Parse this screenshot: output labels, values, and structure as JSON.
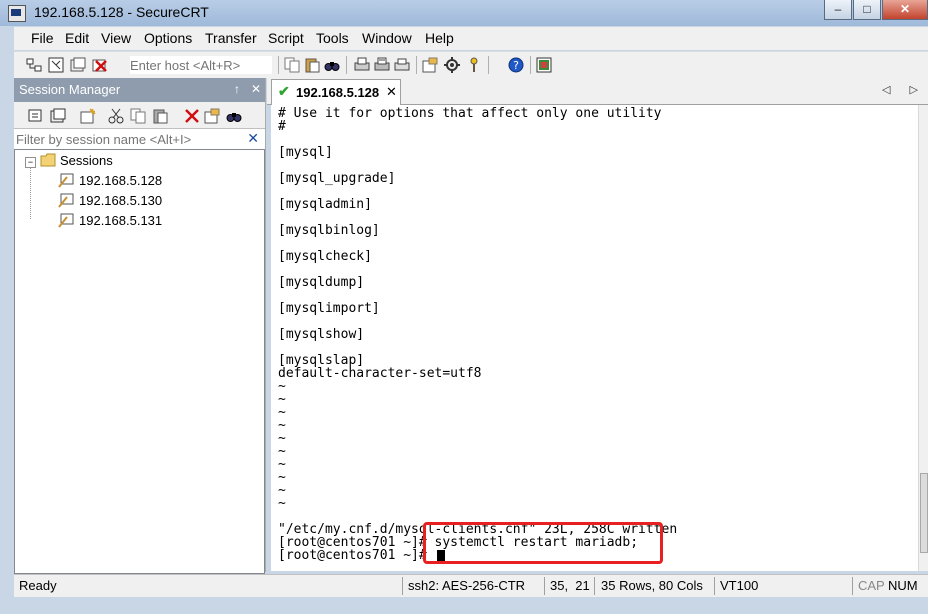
{
  "window": {
    "title": "192.168.5.128 - SecureCRT",
    "buttons": [
      "–",
      "□",
      "✕"
    ]
  },
  "menu": [
    "File",
    "Edit",
    "View",
    "Options",
    "Transfer",
    "Script",
    "Tools",
    "Window",
    "Help"
  ],
  "toolbar": {
    "host_placeholder": "Enter host <Alt+R>"
  },
  "session_manager": {
    "title": "Session Manager",
    "pin_icon": "↑",
    "close_icon": "✕",
    "filter_placeholder": "Filter by session name <Alt+I>",
    "filter_clear": "✕",
    "tree": {
      "expander": "−",
      "folder_label": "Sessions",
      "sessions": [
        "192.168.5.128",
        "192.168.5.130",
        "192.168.5.131"
      ]
    }
  },
  "tabs": [
    {
      "label": "192.168.5.128",
      "status": "✔",
      "close": "✕"
    }
  ],
  "tab_nav": "◁ ▷",
  "terminal": {
    "lines": [
      "# Use it for options that affect only one utility",
      "#",
      "",
      "[mysql]",
      "",
      "[mysql_upgrade]",
      "",
      "[mysqladmin]",
      "",
      "[mysqlbinlog]",
      "",
      "[mysqlcheck]",
      "",
      "[mysqldump]",
      "",
      "[mysqlimport]",
      "",
      "[mysqlshow]",
      "",
      "[mysqlslap]",
      "default-character-set=utf8",
      "~",
      "~",
      "~",
      "~",
      "~",
      "~",
      "~",
      "~",
      "~",
      "~",
      "\"/etc/my.cnf.d/mysql-clients.cnf\" 23L, 258C written",
      "[root@centos701 ~]# systemctl restart mariadb;",
      "[root@centos701 ~]# "
    ]
  },
  "status_bar": {
    "state": "Ready",
    "protocol": "ssh2: AES-256-CTR",
    "cursor_pos": "35,  21",
    "size": "35 Rows, 80 Cols",
    "emulation": "VT100",
    "cap": "CAP",
    "num": "NUM"
  },
  "colors": {
    "highlight_box": "#e82020",
    "title_bar": "#b8cde6",
    "sm_header": "#8e9cad"
  }
}
